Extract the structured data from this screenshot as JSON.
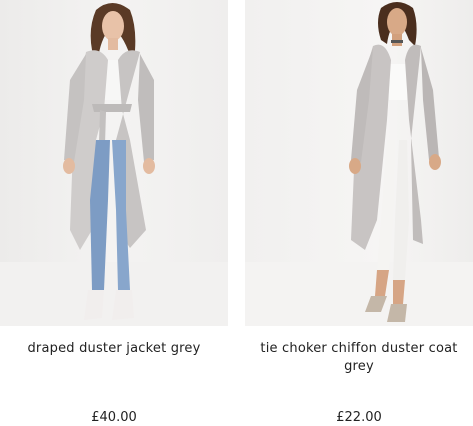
{
  "products": [
    {
      "name": "draped duster jacket grey",
      "price": "£40.00",
      "image": "product-photo-model-grey-duster-jacket"
    },
    {
      "name": "tie choker chiffon duster coat grey",
      "price": "£22.00",
      "image": "product-photo-model-grey-chiffon-duster-coat"
    }
  ],
  "colors": {
    "background": "#ffffff",
    "text": "#222222",
    "coat": "#c9c6c5"
  }
}
